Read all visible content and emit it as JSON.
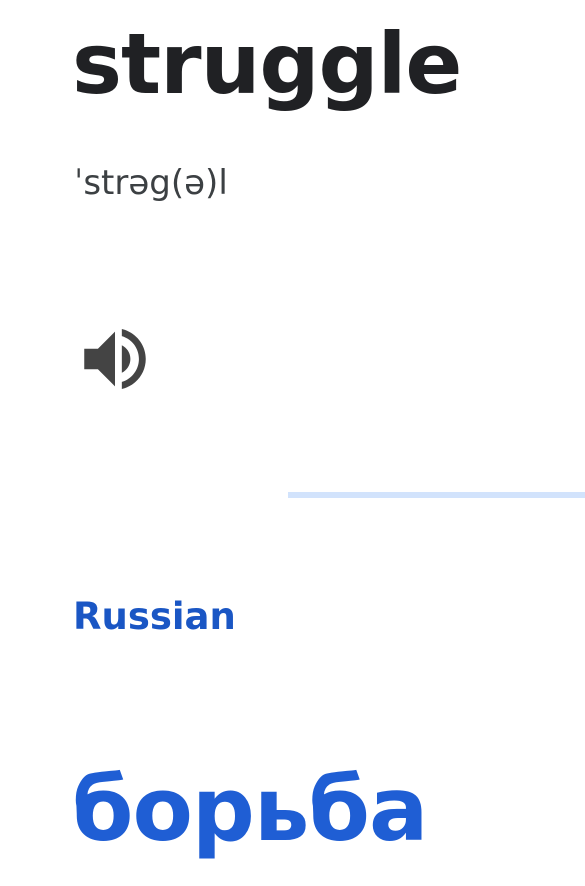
{
  "source": {
    "word": "struggle",
    "phonetic": "ˈstrəg(ə)l",
    "listen_icon": "volume-up-icon"
  },
  "target": {
    "language": "Russian",
    "translation": "борьба"
  },
  "colors": {
    "source_text": "#202124",
    "phonetic_text": "#3c4043",
    "icon": "#444444",
    "accent_blue": "#1a56c4",
    "translation_blue": "#1f5ed4",
    "divider": "#d2e3fc"
  }
}
